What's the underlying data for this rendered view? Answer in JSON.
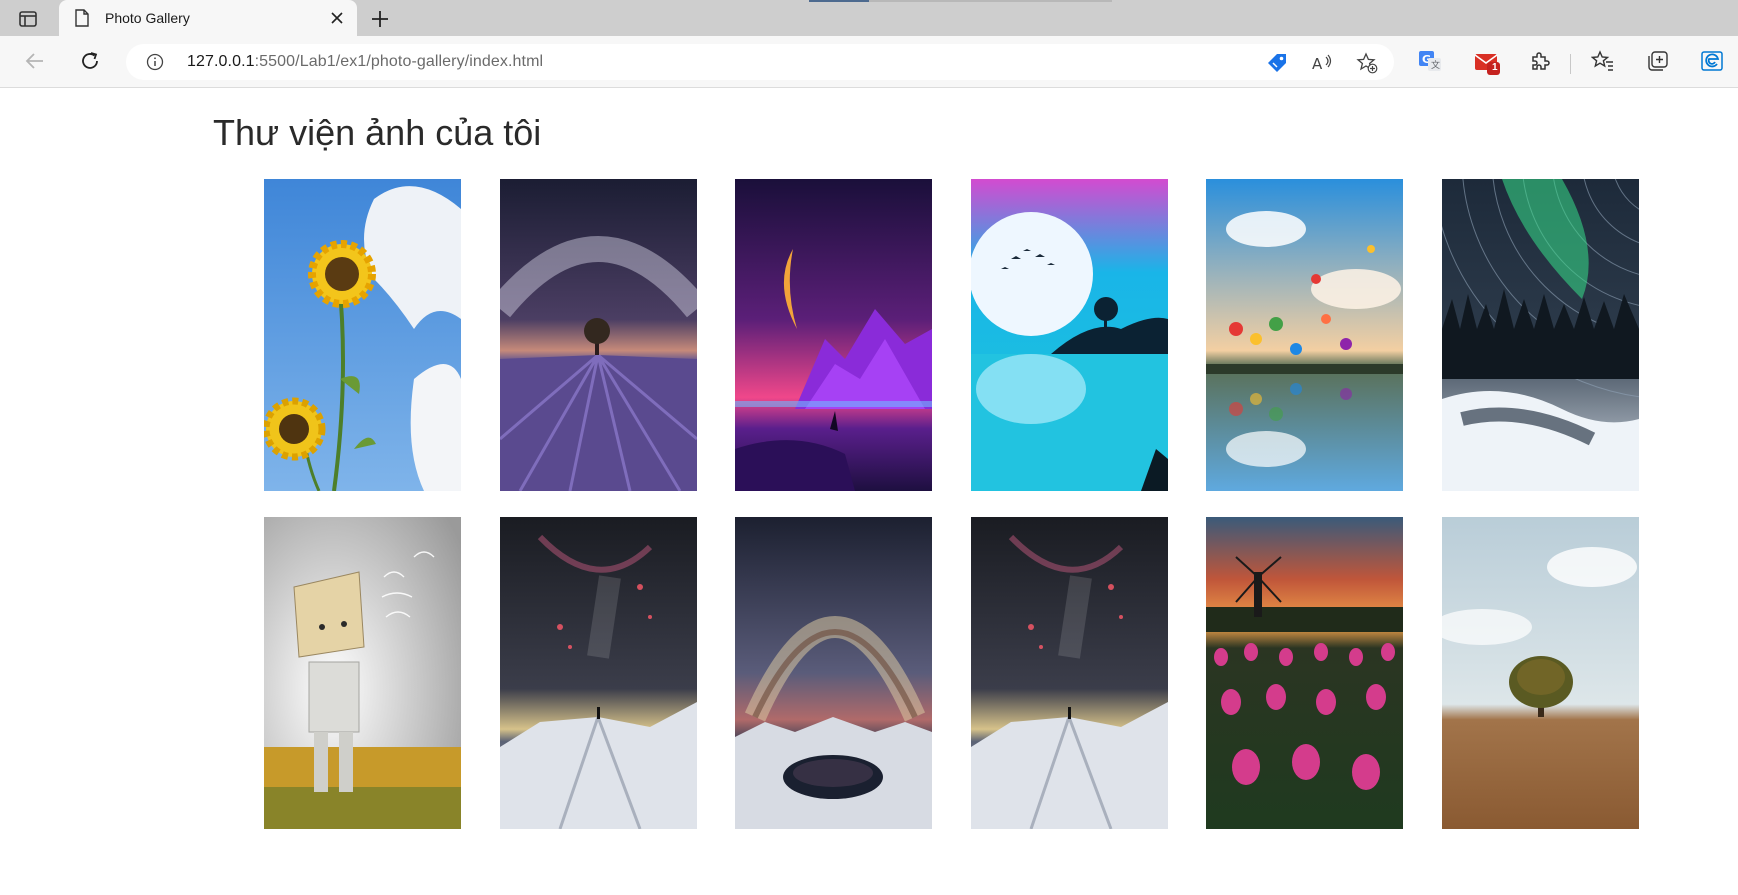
{
  "browser": {
    "tab": {
      "title": "Photo Gallery"
    },
    "address_bar": {
      "host": "127.0.0.1",
      "rest": ":5500/Lab1/ex1/photo-gallery/index.html"
    },
    "mail_badge_count": "1",
    "icons": [
      "sidebar-icon",
      "page-icon",
      "close-icon",
      "plus-icon",
      "back-arrow-icon",
      "reload-icon",
      "info-icon",
      "price-tag-icon",
      "read-aloud-icon",
      "add-favorite-icon",
      "translate-icon",
      "mail-icon",
      "extensions-icon",
      "favorites-icon",
      "collections-icon",
      "edge-icon"
    ]
  },
  "page": {
    "title": "Thư viện ảnh của tôi"
  },
  "gallery": {
    "photos": [
      "sunflower-image",
      "lavender-milky-way-image",
      "purple-mountains-moon-image",
      "full-moon-sea-image",
      "hot-air-balloons-image",
      "aurora-star-trails-image",
      "cardboard-robot-image",
      "mountain-climber-night-image",
      "milky-way-lake-image",
      "mountain-climber-night-image",
      "tulip-field-windmill-image",
      "lone-tree-field-image"
    ]
  }
}
